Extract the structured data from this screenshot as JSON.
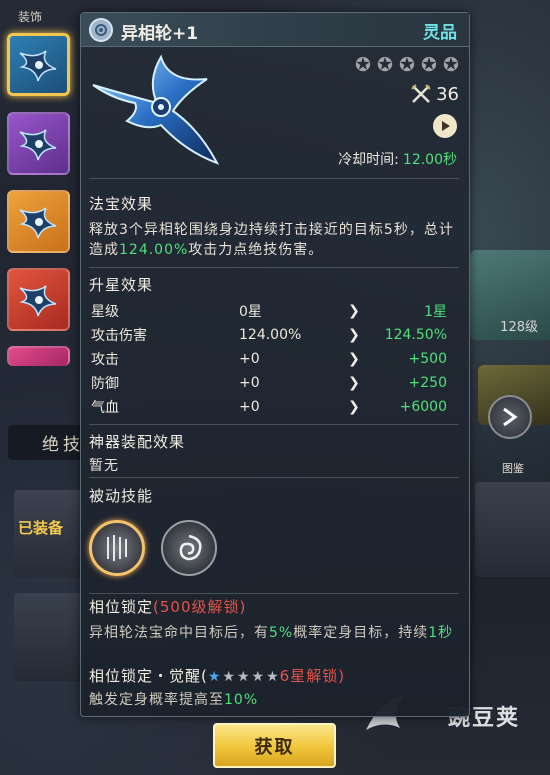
{
  "background": {
    "rail_top_label": "装饰",
    "tab_label": "绝技",
    "equipped_label": "已装备",
    "right_level": "128级",
    "collection_label": "图鉴"
  },
  "item": {
    "name": "异相轮+1",
    "grade": "灵品",
    "stars_total": 5,
    "stars_lit": 0,
    "power": "36",
    "cooldown_label": "冷却时间:",
    "cooldown_value": "12.00秒"
  },
  "treasure_effect": {
    "title": "法宝效果",
    "text_before": "释放3个异相轮围绕身边持续打击接近的目标5秒，总计造成",
    "text_highlight": "124.00%",
    "text_after": "攻击力点绝技伤害。"
  },
  "star_up": {
    "title": "升星效果",
    "rows": [
      {
        "label": "星级",
        "from": "0星",
        "to": "1星"
      },
      {
        "label": "攻击伤害",
        "from": "124.00%",
        "to": "124.50%"
      },
      {
        "label": "攻击",
        "from": "+0",
        "to": "+500"
      },
      {
        "label": "防御",
        "from": "+0",
        "to": "+250"
      },
      {
        "label": "气血",
        "from": "+0",
        "to": "+6000"
      }
    ]
  },
  "artifact_effect": {
    "title": "神器装配效果",
    "value": "暂无"
  },
  "passive": {
    "title": "被动技能"
  },
  "phase_lock": {
    "title": "相位锁定",
    "unlock": "(500级解锁)",
    "desc_before": "异相轮法宝命中目标后，有",
    "desc_highlight1": "5%",
    "desc_middle": "概率定身目标，持续",
    "desc_highlight2": "1秒"
  },
  "phase_awaken": {
    "title": "相位锁定・觉醒(",
    "unlock": "6星解锁)",
    "desc_before": "触发定身概率提高至",
    "desc_highlight": "10%"
  },
  "acquire_label": "获取",
  "watermark": "豌豆荚",
  "colors": {
    "grade": "#6fe2e4",
    "green": "#4fe07a",
    "red": "#e2544a",
    "button": "#f0c53a"
  }
}
